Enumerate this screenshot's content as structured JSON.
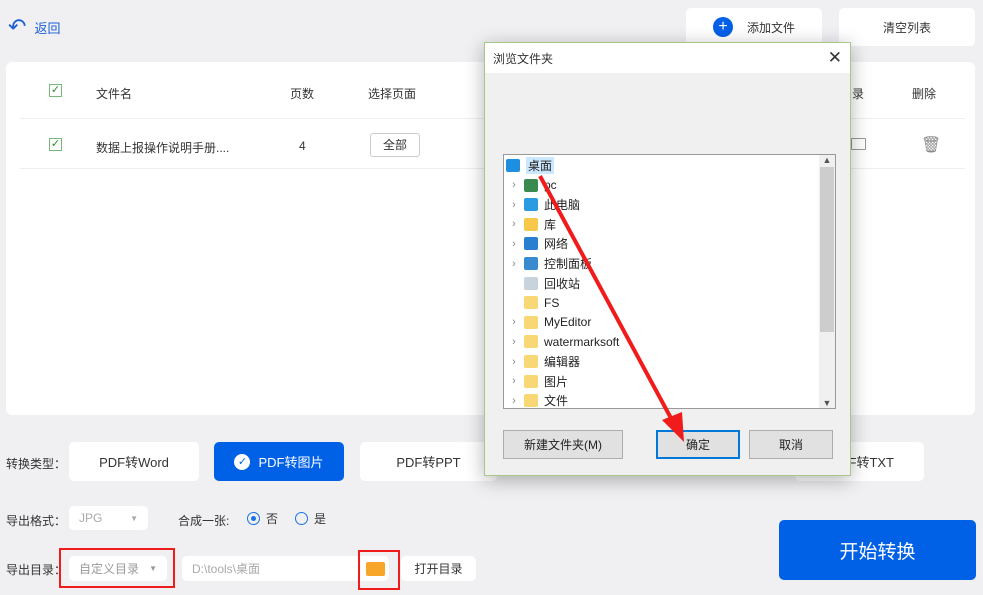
{
  "header": {
    "back_label": "返回",
    "add_file_label": "添加文件",
    "clear_list_label": "清空列表"
  },
  "table": {
    "headers": {
      "filename": "文件名",
      "pages": "页数",
      "select_pages": "选择页面",
      "output_dir": "录",
      "delete": "删除"
    },
    "rows": [
      {
        "filename": "数据上报操作说明手册....",
        "pages": "4",
        "select_pages_button": "全部",
        "checked": true
      }
    ]
  },
  "conversion": {
    "label": "转换类型：",
    "types": [
      "PDF转Word",
      "PDF转图片",
      "PDF转PPT",
      "F转TXT"
    ],
    "selected": "PDF转图片"
  },
  "export_format": {
    "label": "导出格式：",
    "value": "JPG"
  },
  "merge": {
    "label": "合成一张:",
    "options": [
      "否",
      "是"
    ],
    "selected": "否"
  },
  "export_dir": {
    "label": "导出目录：",
    "mode": "自定义目录",
    "path": "D:\\tools\\桌面",
    "open_label": "打开目录"
  },
  "start_label": "开始转换",
  "dialog": {
    "title": "浏览文件夹",
    "tree": [
      {
        "label": "桌面",
        "icon": "desktop-icon",
        "expandable": false,
        "selected": true,
        "level": 0
      },
      {
        "label": "pc",
        "icon": "user-icon",
        "expandable": true,
        "level": 1
      },
      {
        "label": "此电脑",
        "icon": "computer-icon",
        "expandable": true,
        "level": 1
      },
      {
        "label": "库",
        "icon": "library-icon",
        "expandable": true,
        "level": 1
      },
      {
        "label": "网络",
        "icon": "network-icon",
        "expandable": true,
        "level": 1
      },
      {
        "label": "控制面板",
        "icon": "control-panel-icon",
        "expandable": true,
        "level": 1
      },
      {
        "label": "回收站",
        "icon": "recycle-bin-icon",
        "expandable": false,
        "level": 1
      },
      {
        "label": "FS",
        "icon": "folder-icon",
        "expandable": false,
        "level": 1
      },
      {
        "label": "MyEditor",
        "icon": "folder-icon",
        "expandable": true,
        "level": 1
      },
      {
        "label": "watermarksoft",
        "icon": "folder-icon",
        "expandable": true,
        "level": 1
      },
      {
        "label": "编辑器",
        "icon": "folder-icon",
        "expandable": true,
        "level": 1
      },
      {
        "label": "图片",
        "icon": "folder-icon",
        "expandable": true,
        "level": 1
      },
      {
        "label": "文件",
        "icon": "folder-icon",
        "expandable": true,
        "level": 1
      }
    ],
    "new_folder_label": "新建文件夹(M)",
    "ok_label": "确定",
    "cancel_label": "取消"
  },
  "colors": {
    "accent": "#0060e6",
    "annotation": "#f01b1b"
  }
}
